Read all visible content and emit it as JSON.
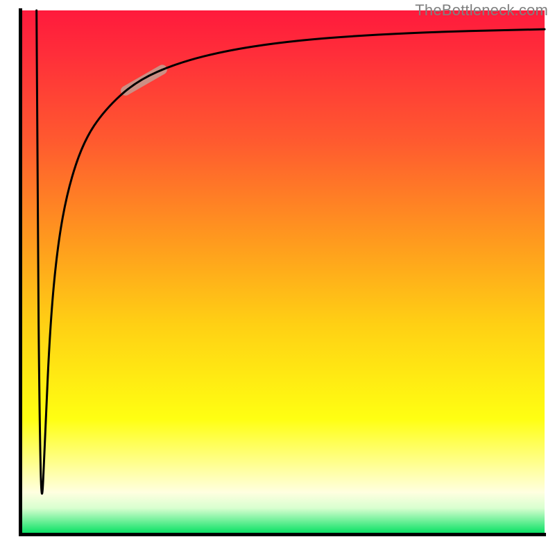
{
  "watermark": "TheBottleneck.com",
  "chart_data": {
    "type": "line",
    "title": "",
    "xlabel": "",
    "ylabel": "",
    "xlim": [
      0,
      100
    ],
    "ylim": [
      0,
      100
    ],
    "grid": false,
    "legend": false,
    "background_gradient_stops": [
      {
        "pos": 0.0,
        "color": "#ff1a3c"
      },
      {
        "pos": 0.08,
        "color": "#ff2d3a"
      },
      {
        "pos": 0.25,
        "color": "#ff5a2f"
      },
      {
        "pos": 0.44,
        "color": "#ff9a1e"
      },
      {
        "pos": 0.6,
        "color": "#ffd014"
      },
      {
        "pos": 0.78,
        "color": "#ffff12"
      },
      {
        "pos": 0.86,
        "color": "#ffff88"
      },
      {
        "pos": 0.92,
        "color": "#ffffe0"
      },
      {
        "pos": 0.95,
        "color": "#d9ffd0"
      },
      {
        "pos": 1.0,
        "color": "#00e060"
      }
    ],
    "series": [
      {
        "name": "bottleneck-curve",
        "color": "#000000",
        "stroke_width": 3,
        "points": [
          {
            "x": 3.0,
            "y": 100.0
          },
          {
            "x": 3.2,
            "y": 60.0
          },
          {
            "x": 3.6,
            "y": 20.0
          },
          {
            "x": 4.0,
            "y": 4.0
          },
          {
            "x": 4.6,
            "y": 18.0
          },
          {
            "x": 5.6,
            "y": 40.0
          },
          {
            "x": 7.0,
            "y": 55.0
          },
          {
            "x": 9.0,
            "y": 66.0
          },
          {
            "x": 12.0,
            "y": 75.0
          },
          {
            "x": 16.0,
            "y": 81.0
          },
          {
            "x": 22.0,
            "y": 86.5
          },
          {
            "x": 30.0,
            "y": 90.0
          },
          {
            "x": 40.0,
            "y": 92.5
          },
          {
            "x": 52.0,
            "y": 94.2
          },
          {
            "x": 66.0,
            "y": 95.3
          },
          {
            "x": 82.0,
            "y": 96.0
          },
          {
            "x": 100.0,
            "y": 96.4
          }
        ]
      }
    ],
    "highlight_segment": {
      "series": "bottleneck-curve",
      "x_range": [
        20,
        27
      ],
      "color": "#cc8f84",
      "stroke_width": 14
    }
  }
}
